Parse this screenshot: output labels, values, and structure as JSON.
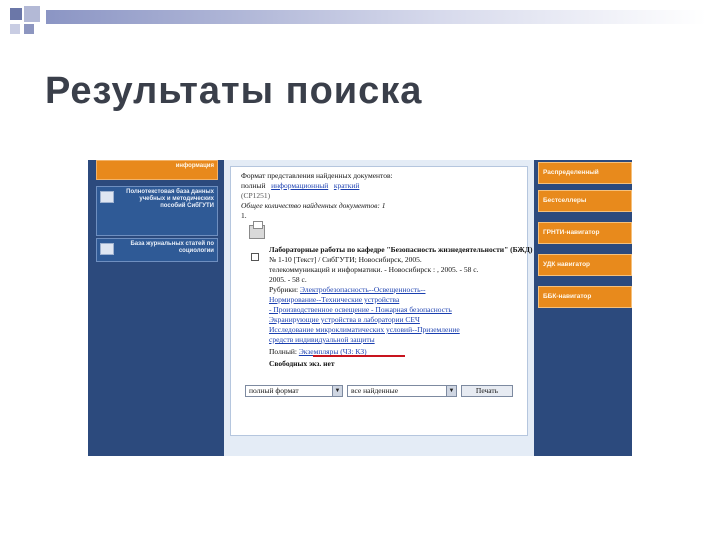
{
  "slide_title": "Результаты поиска",
  "left_panel": [
    {
      "label": "информация"
    },
    {
      "label": "Полнотекстовая база данных учебных и методических пособий СибГУТИ"
    },
    {
      "label": "База журнальных статей по социологии"
    }
  ],
  "content": {
    "format_label": "Формат представления найденных документов:",
    "format_short": "полный",
    "format_info": "информационный",
    "format_brief": "краткий",
    "format_extra": "(CP1251)",
    "found_label": "Общее количество найденных документов: 1",
    "item_num": "1.",
    "record_title": "Лабораторные работы по кафедре \"Безопасность жизнедеятельности\" (БЖД)",
    "record_line2": "№ 1-10 [Текст] / СибГУТИ; Новосибирск, 2005.",
    "record_line3": "телекоммуникаций и информатики. - Новосибирск : , 2005. - 58 с.",
    "record_line4": "2005. - 58 с.",
    "rubric_label": "Рубрики:",
    "rubric_1": "Электробезопасность--Освещенность--",
    "rubric_2": "Нормирование--Технические устройства",
    "rubric_3": "- Производственное освещение - Пожарная безопасность",
    "rubric_4": "Экранирующие устройства в лаборатории СЕЧ",
    "rubric_5": "Исследование микроклиматических условий--Приземление",
    "rubric_6": "средств индивидуальной защиты",
    "copies_label": "Полный:",
    "copies_link": "Экземпляры (ЧЗ: КЗ)",
    "free_copies": "Свободных экз. нет"
  },
  "controls": {
    "format_select": "полный формат",
    "scope_select": "все найденные",
    "print_button": "Печать"
  },
  "right_menu": [
    {
      "label": "Распределенный"
    },
    {
      "label": "Бестселлеры"
    },
    {
      "label": "ГРНТИ-навигатор"
    },
    {
      "label": "УДК навигатор"
    },
    {
      "label": "ББК-навигатор"
    }
  ],
  "colors": {
    "panel_blue": "#2c4a7d",
    "menu_orange": "#e88a1c",
    "link_blue": "#1a3fb0",
    "underline_red": "#c8141e"
  }
}
